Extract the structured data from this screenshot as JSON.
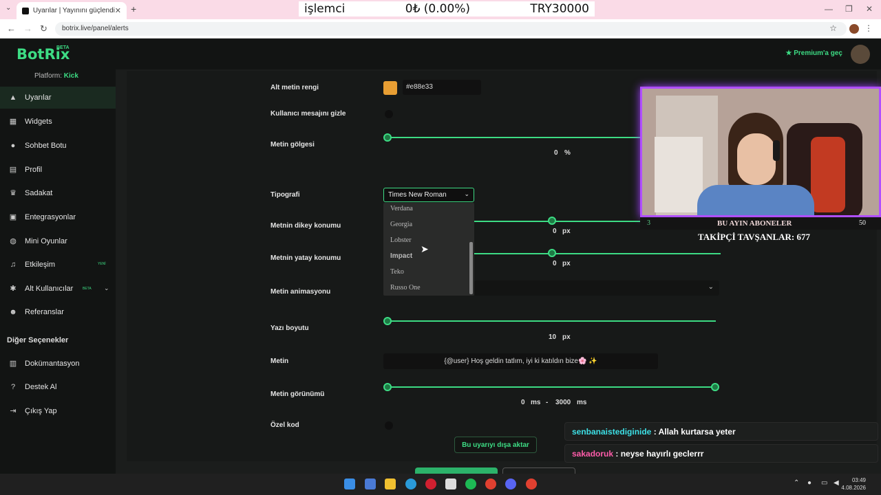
{
  "browser": {
    "tab_title": "Uyarılar | Yayınını güçlendirme",
    "url": "botrix.live/panel/alerts"
  },
  "ticker": {
    "label": "işlemci",
    "amount": "0₺ (0.00%)",
    "target": "TRY30000"
  },
  "app": {
    "logo": "BotRix",
    "beta": "BETA",
    "premium": "Premium'a geç",
    "platform_label": "Platform:",
    "platform_value": "Kick"
  },
  "sidebar": {
    "items": [
      {
        "label": "Uyarılar",
        "icon": "warning-icon"
      },
      {
        "label": "Widgets",
        "icon": "grid-icon"
      },
      {
        "label": "Sohbet Botu",
        "icon": "robot-icon"
      },
      {
        "label": "Profil",
        "icon": "id-card-icon"
      },
      {
        "label": "Sadakat",
        "icon": "trophy-icon"
      },
      {
        "label": "Entegrasyonlar",
        "icon": "integration-icon"
      },
      {
        "label": "Mini Oyunlar",
        "icon": "gamepad-icon"
      },
      {
        "label": "Etkileşim",
        "icon": "music-icon",
        "badge": "YENİ"
      },
      {
        "label": "Alt Kullanıcılar",
        "icon": "users-icon",
        "badge": "BETA"
      },
      {
        "label": "Referanslar",
        "icon": "referral-icon"
      }
    ],
    "section": "Diğer Seçenekler",
    "other": [
      {
        "label": "Dokümantasyon",
        "icon": "document-icon"
      },
      {
        "label": "Destek Al",
        "icon": "help-icon"
      },
      {
        "label": "Çıkış Yap",
        "icon": "logout-icon"
      }
    ]
  },
  "form": {
    "alt_color_label": "Alt metin rengi",
    "alt_color_value": "#e88e33",
    "alt_color_swatch": "#e89e33",
    "hide_msg_label": "Kullanıcı mesajını gizle",
    "shadow_label": "Metin gölgesi",
    "shadow_value": "0",
    "shadow_unit": "%",
    "typo_label": "Tipografi",
    "typo_value": "Times New Roman",
    "typo_options": [
      "Verdana",
      "Georgia",
      "Lobster",
      "Impact",
      "Teko",
      "Russo One"
    ],
    "vpos_label": "Metnin dikey konumu",
    "vpos_value": "0",
    "hpos_label": "Metnin yatay konumu",
    "hpos_value": "0",
    "px": "px",
    "anim_label": "Metin animasyonu",
    "size_label": "Yazı boyutu",
    "size_value": "10",
    "text_label": "Metin",
    "text_value": "{@user} Hoş geldin tatlım, iyi ki katıldın bize🌸 ✨",
    "appear_label": "Metin görünümü",
    "appear_from": "0",
    "appear_to": "3000",
    "ms": "ms",
    "dash": "-",
    "custom_label": "Özel kod",
    "export_label": "Bu uyarıyı dışa aktar"
  },
  "overlay": {
    "subs_count_left": "3",
    "subs_title": "BU AYIN ABONELER",
    "subs_count_right": "50",
    "followers": "TAKİPÇİ TAVŞANLAR: 677"
  },
  "chat": [
    {
      "user": "senbanaistediginide",
      "text": ": Allah kurtarsa yeter"
    },
    {
      "user": "sakadoruk",
      "text": ": neyse hayırlı geclerrr"
    }
  ],
  "clock": {
    "time": "03:49",
    "date": "4.08.2026"
  },
  "colors": {
    "accent": "#3ddc84",
    "swatch": "#e89e33",
    "cam_border": "#b04fff"
  }
}
